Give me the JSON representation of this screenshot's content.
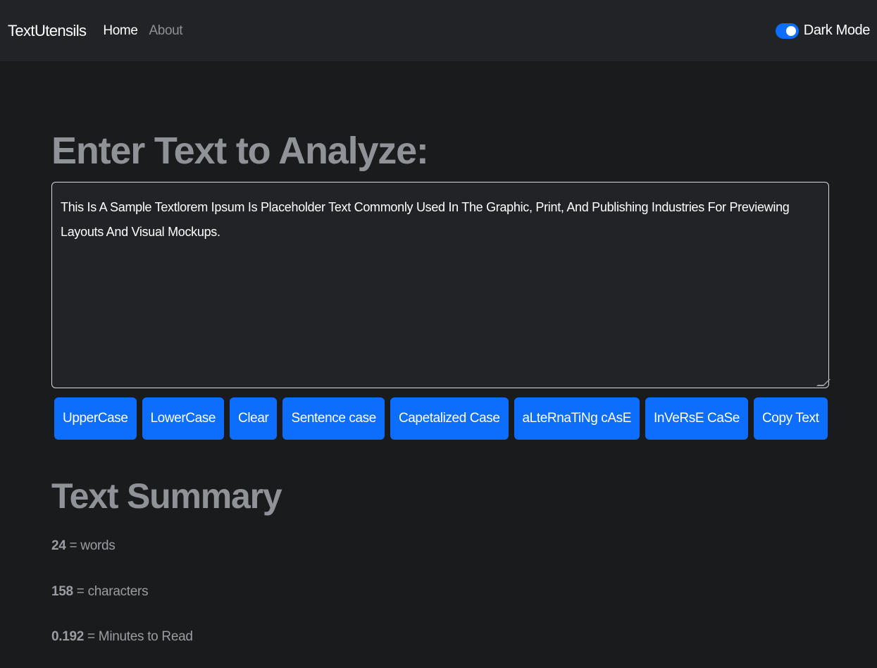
{
  "navbar": {
    "brand": "TextUtensils",
    "links": [
      "Home",
      "About"
    ],
    "toggle_label": "Dark Mode"
  },
  "main": {
    "heading": "Enter Text to Analyze:",
    "textarea_value": "This Is A Sample Textlorem Ipsum Is Placeholder Text Commonly Used In The Graphic, Print, And Publishing Industries For Previewing Layouts And Visual Mockups.",
    "buttons": [
      "UpperCase",
      "LowerCase",
      "Clear",
      "Sentence case",
      "Capetalized Case",
      "aLteRnaTiNg cAsE",
      "InVeRsE CaSe",
      "Copy Text"
    ]
  },
  "summary": {
    "heading": "Text Summary",
    "words_value": "24",
    "words_label": " = words",
    "chars_value": "158",
    "chars_label": " = characters",
    "read_value": "0.192",
    "read_label": " = Minutes to Read"
  },
  "colors": {
    "accent": "#0d6efd",
    "navbar_bg": "#212326",
    "page_bg": "#1a1b1d"
  }
}
